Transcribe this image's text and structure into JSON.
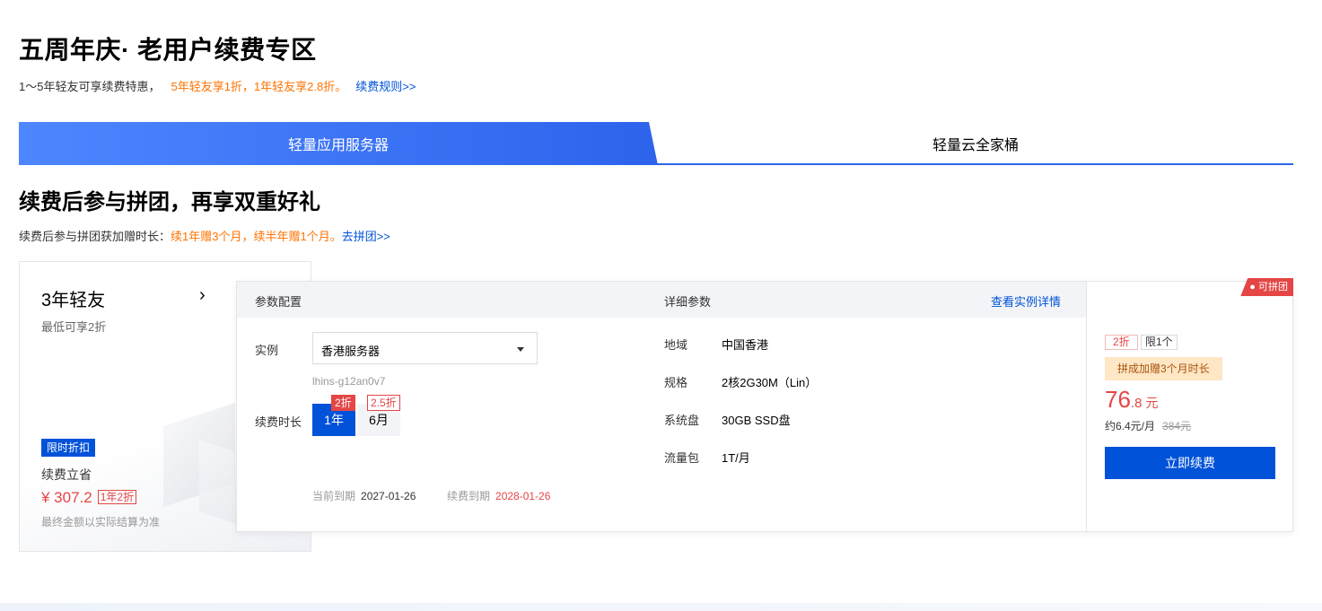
{
  "header": {
    "title": "五周年庆· 老用户续费专区",
    "sub_prefix": "1～5年轻友可享续费特惠，",
    "sub_highlight": "5年轻友享1折，1年轻友享2.8折。",
    "sub_link": "续费规则>>"
  },
  "tabs": [
    {
      "label": "轻量应用服务器",
      "active": true
    },
    {
      "label": "轻量云全家桶",
      "active": false
    }
  ],
  "section": {
    "title": "续费后参与拼团，再享双重好礼",
    "sub_prefix": "续费后参与拼团获加赠时长：",
    "sub_highlight": "续1年赠3个月，续半年赠1个月。",
    "sub_link": "去拼团>>"
  },
  "left_card": {
    "title": "3年轻友",
    "arrow": "›",
    "subtitle": "最低可享2折",
    "badge": "限时折扣",
    "save_label": "续费立省",
    "price": "¥ 307.2",
    "price_tag": "1年2折",
    "note": "最终金额以实际结算为准"
  },
  "main_card": {
    "header": {
      "config": "参数配置",
      "details": "详细参数",
      "view_link": "查看实例详情"
    },
    "instance_label": "实例",
    "instance_value": "香港服务器",
    "instance_id": "lhins-g12an0v7",
    "duration_label": "续费时长",
    "durations": [
      {
        "label": "1年",
        "discount": "2折",
        "selected": true
      },
      {
        "label": "6月",
        "discount": "2.5折",
        "selected": false
      }
    ],
    "current_expiry_label": "当前到期",
    "current_expiry": "2027-01-26",
    "renew_expiry_label": "续费到期",
    "renew_expiry": "2028-01-26",
    "specs": [
      {
        "key": "地域",
        "value": "中国香港"
      },
      {
        "key": "规格",
        "value": "2核2G30M（Lin）"
      },
      {
        "key": "系统盘",
        "value": "30GB SSD盘"
      },
      {
        "key": "流量包",
        "value": "1T/月"
      }
    ]
  },
  "price_panel": {
    "group_tag": "可拼团",
    "discount": "2折",
    "limit": "限1个",
    "gift": "拼成加赠3个月时长",
    "price_int": "76",
    "price_dec": ".8",
    "price_unit": "元",
    "monthly": "约6.4元/月",
    "original": "384元",
    "button": "立即续费"
  },
  "colors": {
    "accent_blue": "#0052d9",
    "tab_gradient_start": "#4e86ff",
    "tab_gradient_end": "#2d63ec",
    "orange": "#ff7200",
    "red": "#e54545",
    "gift_bg": "#ffe6c4"
  }
}
